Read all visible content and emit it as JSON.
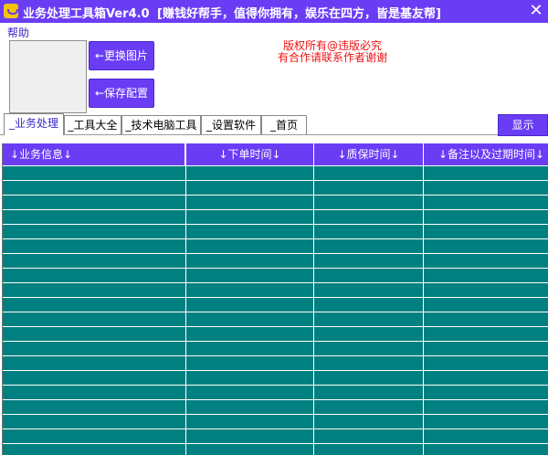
{
  "window": {
    "title": "业务处理工具箱Ver4.0",
    "slogan": "[赚钱好帮手，值得你拥有，娱乐在四方，皆是基友帮]",
    "close_glyph": "✕",
    "accent_color": "#6a3df5"
  },
  "menu": {
    "help": "帮助"
  },
  "buttons": {
    "change_image": "←更换图片",
    "save_config": "←保存配置",
    "show": "显示"
  },
  "copyright": {
    "line1": "版权所有@违版必究",
    "line2": "有合作请联系作者谢谢",
    "color": "#ee1111"
  },
  "tabs": [
    {
      "label": "_业务处理",
      "active": true
    },
    {
      "label": "_工具大全",
      "active": false
    },
    {
      "label": "_技术电脑工具",
      "active": false
    },
    {
      "label": "_设置软件",
      "active": false
    },
    {
      "label": "_首页",
      "active": false
    }
  ],
  "grid": {
    "columns": [
      "↓业务信息↓",
      "↓下单时间↓",
      "↓质保时间↓",
      "↓备注以及过期时间↓"
    ],
    "row_color": "#008080"
  }
}
